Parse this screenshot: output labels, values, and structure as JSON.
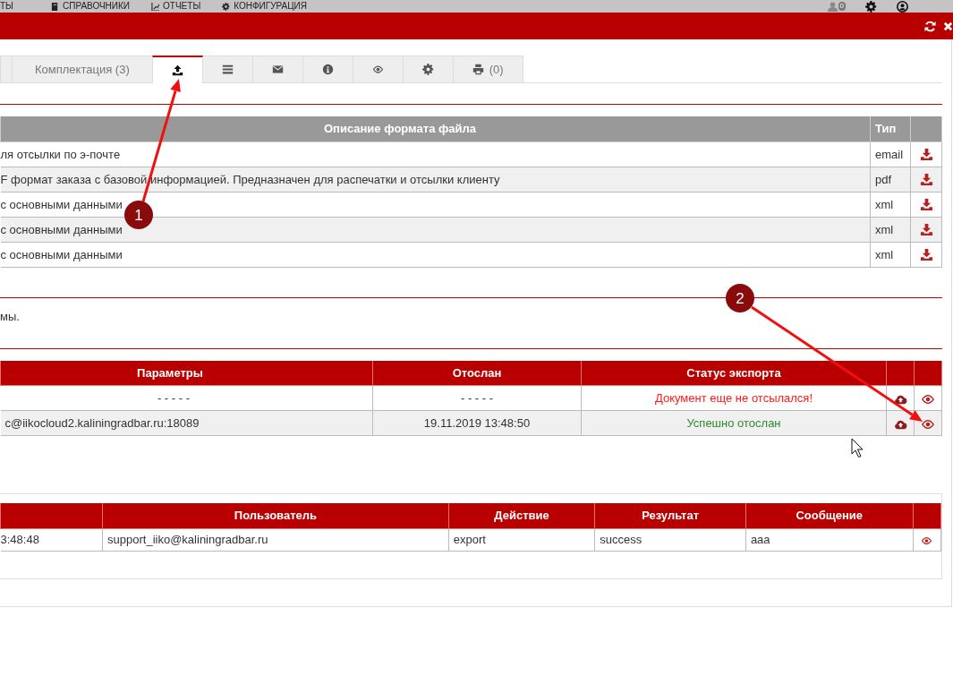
{
  "top_nav": {
    "items": [
      {
        "label": "ТЫ"
      },
      {
        "label": "СПРАВОЧНИКИ"
      },
      {
        "label": "ОТЧЕТЫ"
      },
      {
        "label": "КОНФИГУРАЦИЯ"
      }
    ],
    "notifications": "0"
  },
  "tabs": [
    {
      "selected": false
    },
    {
      "label": "Комплектация (3)",
      "selected": false
    },
    {
      "selected": true
    },
    {
      "selected": false
    },
    {
      "selected": false
    },
    {
      "selected": false
    },
    {
      "selected": false
    },
    {
      "selected": false
    },
    {
      "label": "(0)",
      "selected": false
    }
  ],
  "formats_table": {
    "columns": [
      "Описание формата файла",
      "Тип"
    ],
    "rows": [
      {
        "description": "ля отсылки по э-почте",
        "type": "email"
      },
      {
        "description": "F формат заказа с базовой информацией. Предназначен для распечатки и отсылки клиенту",
        "type": "pdf"
      },
      {
        "description": "с основными данными",
        "type": "xml"
      },
      {
        "description": "с основными данными",
        "type": "xml"
      },
      {
        "description": "с основными данными",
        "type": "xml"
      }
    ]
  },
  "note": "мы.",
  "export_table": {
    "columns": [
      "Параметры",
      "Отослан",
      "Статус экспорта"
    ],
    "rows": [
      {
        "parameters": "- - - - -",
        "sent": "- - - - -",
        "status": "Документ еще не отсылался!",
        "color": "#ff1a1a"
      },
      {
        "parameters": "c@iikocloud2.kaliningradbar.ru:18089",
        "sent": "19.11.2019 13:48:50",
        "status": "Успешно отослан",
        "color": "#2e8b2e"
      }
    ]
  },
  "log_table": {
    "columns": [
      "Пользователь",
      "Действие",
      "Результат",
      "Сообщение"
    ],
    "rows": [
      {
        "time": "3:48:48",
        "user": "support_iiko@kaliningradbar.ru",
        "action": "export",
        "result": "success",
        "message": "aaa"
      }
    ]
  },
  "annotations": [
    {
      "label": "1"
    },
    {
      "label": "2"
    }
  ]
}
